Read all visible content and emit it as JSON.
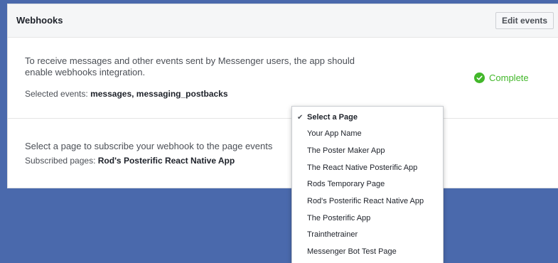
{
  "panel": {
    "title": "Webhooks",
    "edit_button": "Edit events",
    "description": "To receive messages and other events sent by Messenger users, the app should enable webhooks integration.",
    "selected_events_label": "Selected events:",
    "selected_events_value": "messages, messaging_postbacks",
    "status": "Complete",
    "subscribe_text": "Select a page to subscribe your webhook to the page events",
    "subscribed_pages_label": "Subscribed pages:",
    "subscribed_pages_value": "Rod's Posterific React Native App"
  },
  "dropdown": {
    "items": [
      {
        "label": "Select a Page",
        "selected": true
      },
      {
        "label": "Your App Name",
        "selected": false
      },
      {
        "label": "The Poster Maker App",
        "selected": false
      },
      {
        "label": "The React Native Posterific App",
        "selected": false
      },
      {
        "label": "Rods Temporary Page",
        "selected": false
      },
      {
        "label": "Rod's Posterific React Native App",
        "selected": false
      },
      {
        "label": "The Posterific App",
        "selected": false
      },
      {
        "label": "Trainthetrainer",
        "selected": false
      },
      {
        "label": "Messenger Bot Test Page",
        "selected": false
      }
    ]
  },
  "colors": {
    "background": "#4a69ac",
    "success": "#42b72a"
  },
  "icons": {
    "status": "check-circle-icon",
    "selected_item": "checkmark-icon"
  }
}
